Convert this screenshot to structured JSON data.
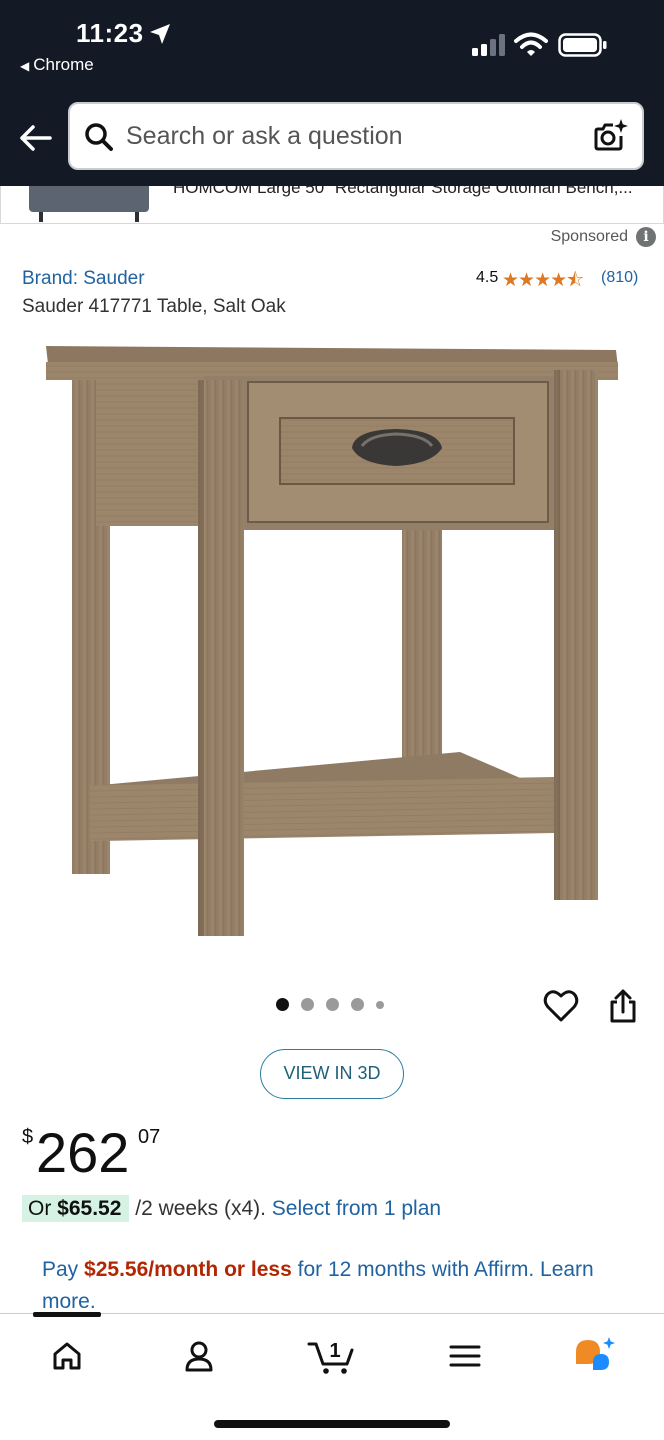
{
  "status_bar": {
    "time": "11:23",
    "back_app": "Chrome"
  },
  "search": {
    "placeholder": "Search or ask a question"
  },
  "sponsored_strip": {
    "text": "HOMCOM Large 50\" Rectangular Storage Ottoman Bench,..."
  },
  "sponsored": {
    "label": "Sponsored",
    "info_glyph": "i"
  },
  "product": {
    "brand_link": "Brand: Sauder",
    "title": "Sauder 417771 Table, Salt Oak",
    "rating": "4.5",
    "rating_value": 4.5,
    "stars_glyphs": "★★★★⯪",
    "rating_count": "(810)",
    "image_count": 5,
    "active_image": 1,
    "view_3d_label": "VIEW IN 3D"
  },
  "price": {
    "symbol": "$",
    "whole": "262",
    "fraction": "07"
  },
  "installment": {
    "prefix": "Or ",
    "amount": "$65.52",
    "suffix": " /2 weeks (x4). ",
    "link": "Select from 1 plan"
  },
  "affirm": {
    "prefix": "Pay ",
    "amount": "$25.56/month or less",
    "suffix": " for 12 months with Affirm. ",
    "link": "Learn more."
  },
  "bottom_nav": {
    "cart_count": "1",
    "items": [
      "home-icon",
      "account-icon",
      "cart-icon",
      "menu-icon",
      "rufus-icon"
    ]
  },
  "colors": {
    "top_bar": "#131a26",
    "link": "#2162a1",
    "star": "#de7921",
    "deal_red": "#b12704",
    "installment_chip": "#d6f2e5",
    "rufus_orange": "#f08a24",
    "rufus_blue": "#1a8cff"
  }
}
